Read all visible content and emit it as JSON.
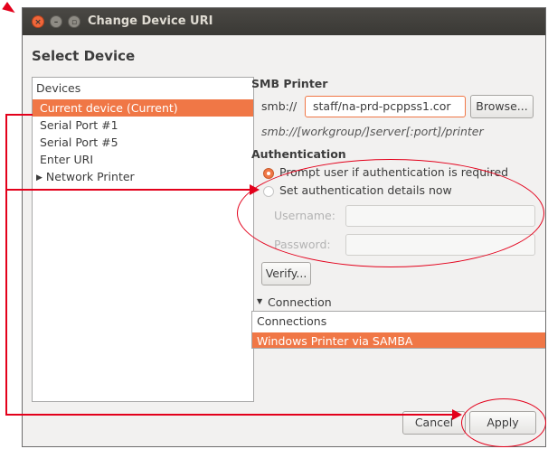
{
  "window": {
    "title": "Change Device URI",
    "heading": "Select Device",
    "close_glyph": "×",
    "min_glyph": "–",
    "max_glyph": "▫"
  },
  "devices": {
    "header": "Devices",
    "items": [
      {
        "label": "Current device (Current)",
        "selected": true
      },
      {
        "label": "Serial Port #1",
        "selected": false
      },
      {
        "label": "Serial Port #5",
        "selected": false
      },
      {
        "label": "Enter URI",
        "selected": false
      },
      {
        "label": "Network Printer",
        "selected": false,
        "expandable": true
      }
    ],
    "expander_glyph": "▶"
  },
  "smb": {
    "section_title": "SMB Printer",
    "prefix": "smb://",
    "uri_value": "staff/na-prd-pcppss1.cor",
    "browse_label": "Browse...",
    "hint": "smb://[workgroup/]server[:port]/printer"
  },
  "auth": {
    "section_title": "Authentication",
    "prompt_option": "Prompt user if authentication is required",
    "set_option": "Set authentication details now",
    "username_label": "Username:",
    "password_label": "Password:",
    "username_value": "",
    "password_value": "",
    "verify_label": "Verify..."
  },
  "connection": {
    "expander_glyph": "▼",
    "section_title": "Connection",
    "list_header": "Connections",
    "selected_item": "Windows Printer via SAMBA"
  },
  "buttons": {
    "cancel": "Cancel",
    "apply": "Apply"
  },
  "colors": {
    "accent": "#f07746",
    "annotation": "#e3001b",
    "titlebar": "#3c3b37"
  }
}
